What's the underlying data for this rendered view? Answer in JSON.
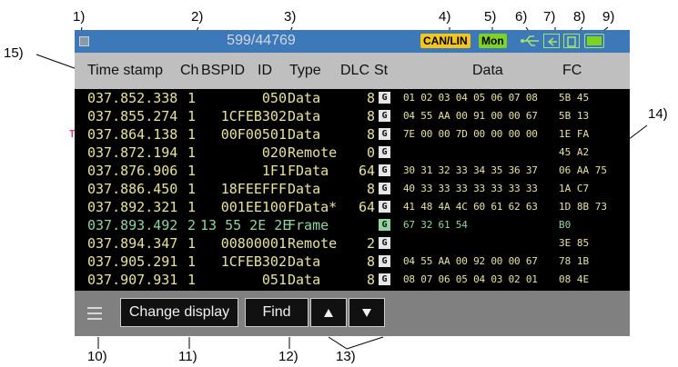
{
  "callouts": {
    "c1": "1)",
    "c2": "2)",
    "c3": "3)",
    "c4": "4)",
    "c5": "5)",
    "c6": "6)",
    "c7": "7)",
    "c8": "8)",
    "c9": "9)",
    "c10": "10)",
    "c11": "11)",
    "c12": "12)",
    "c13": "13)",
    "c14": "14)",
    "c15": "15)"
  },
  "statusbar": {
    "counter": "599/44769",
    "canlin_badge": "CAN/LIN",
    "mode_badge": "Mon",
    "icons": [
      "stop-icon",
      "usb-icon",
      "memory-icon",
      "card-icon",
      "battery-icon"
    ]
  },
  "header": {
    "time_stamp": "Time stamp",
    "ch": "Ch",
    "bspid": "BSPID",
    "id": "ID",
    "type": "Type",
    "dlc": "DLC",
    "st": "St",
    "data": "Data",
    "fc": "FC"
  },
  "rows": [
    {
      "ts": "037.852.338",
      "ch": "1",
      "id": "050",
      "type": "Data",
      "dlc": "8",
      "st": "G",
      "data": "01 02 03 04 05 06 07 08",
      "fc": "5B 45",
      "trigger": "",
      "color": "#e8e29a"
    },
    {
      "ts": "037.855.274",
      "ch": "1",
      "id": "1CFEB302",
      "type": "Data",
      "dlc": "8",
      "st": "G",
      "data": "04 55 AA 00 91 00 00 67",
      "fc": "5B 13",
      "trigger": "",
      "color": "#e8e29a"
    },
    {
      "ts": "037.864.138",
      "ch": "1",
      "id": "00F00501",
      "type": "Data",
      "dlc": "8",
      "st": "G",
      "data": "7E 00 00 7D 00 00 00 00",
      "fc": "1E FA",
      "trigger": "T",
      "color": "#e8e29a"
    },
    {
      "ts": "037.872.194",
      "ch": "1",
      "id": "020",
      "type": "Remote",
      "dlc": "0",
      "st": "G",
      "data": "",
      "fc": "45 A2",
      "trigger": "",
      "color": "#e8e29a"
    },
    {
      "ts": "037.876.906",
      "ch": "1",
      "id": "1F1",
      "type": "FData",
      "dlc": "64",
      "st": "G",
      "data": "30 31 32 33 34 35 36 37",
      "fc": "06 AA 75",
      "trigger": "",
      "color": "#e8e29a"
    },
    {
      "ts": "037.886.450",
      "ch": "1",
      "id": "18FEEFFF",
      "type": "Data",
      "dlc": "8",
      "st": "G",
      "data": "40 33 33 33 33 33 33 33",
      "fc": "1A C7",
      "trigger": "",
      "color": "#e8e29a"
    },
    {
      "ts": "037.892.321",
      "ch": "1",
      "id": "001EE100",
      "type": "FData*",
      "dlc": "64",
      "st": "G",
      "data": "41 48 4A 4C 60 61 62 63",
      "fc": "1D 8B 73",
      "trigger": "",
      "color": "#e8e29a"
    },
    {
      "ts": "037.893.492",
      "ch": "2",
      "id": "13 55 2E 2E",
      "type": "Frame",
      "dlc": "",
      "st": "G",
      "data": "67 32 61 54",
      "fc": "B0",
      "trigger": "",
      "color": "#8fd3a0"
    },
    {
      "ts": "037.894.347",
      "ch": "1",
      "id": "00800001",
      "type": "Remote",
      "dlc": "2",
      "st": "G",
      "data": "",
      "fc": "3E 85",
      "trigger": "",
      "color": "#e8e29a"
    },
    {
      "ts": "037.905.291",
      "ch": "1",
      "id": "1CFEB302",
      "type": "Data",
      "dlc": "8",
      "st": "G",
      "data": "04 55 AA 00 92 00 00 67",
      "fc": "78 1B",
      "trigger": "",
      "color": "#e8e29a"
    },
    {
      "ts": "037.907.931",
      "ch": "1",
      "id": "051",
      "type": "Data",
      "dlc": "8",
      "st": "G",
      "data": "08 07 06 05 04 03 02 01",
      "fc": "08 4E",
      "trigger": "",
      "color": "#e8e29a"
    }
  ],
  "toolbar": {
    "change_display_label": "Change display",
    "find_label": "Find"
  },
  "colors": {
    "statusbar_bg": "#3d79b8",
    "header_bg": "#bfbfbf",
    "log_bg": "#000000",
    "data_text": "#e8e29a",
    "lin_frame_text": "#8fd3a0",
    "canlin_badge": "#f5c518",
    "mon_badge": "#7ed321",
    "trigger_mark": "#e83a6a",
    "toolbar_bg": "#808080"
  }
}
